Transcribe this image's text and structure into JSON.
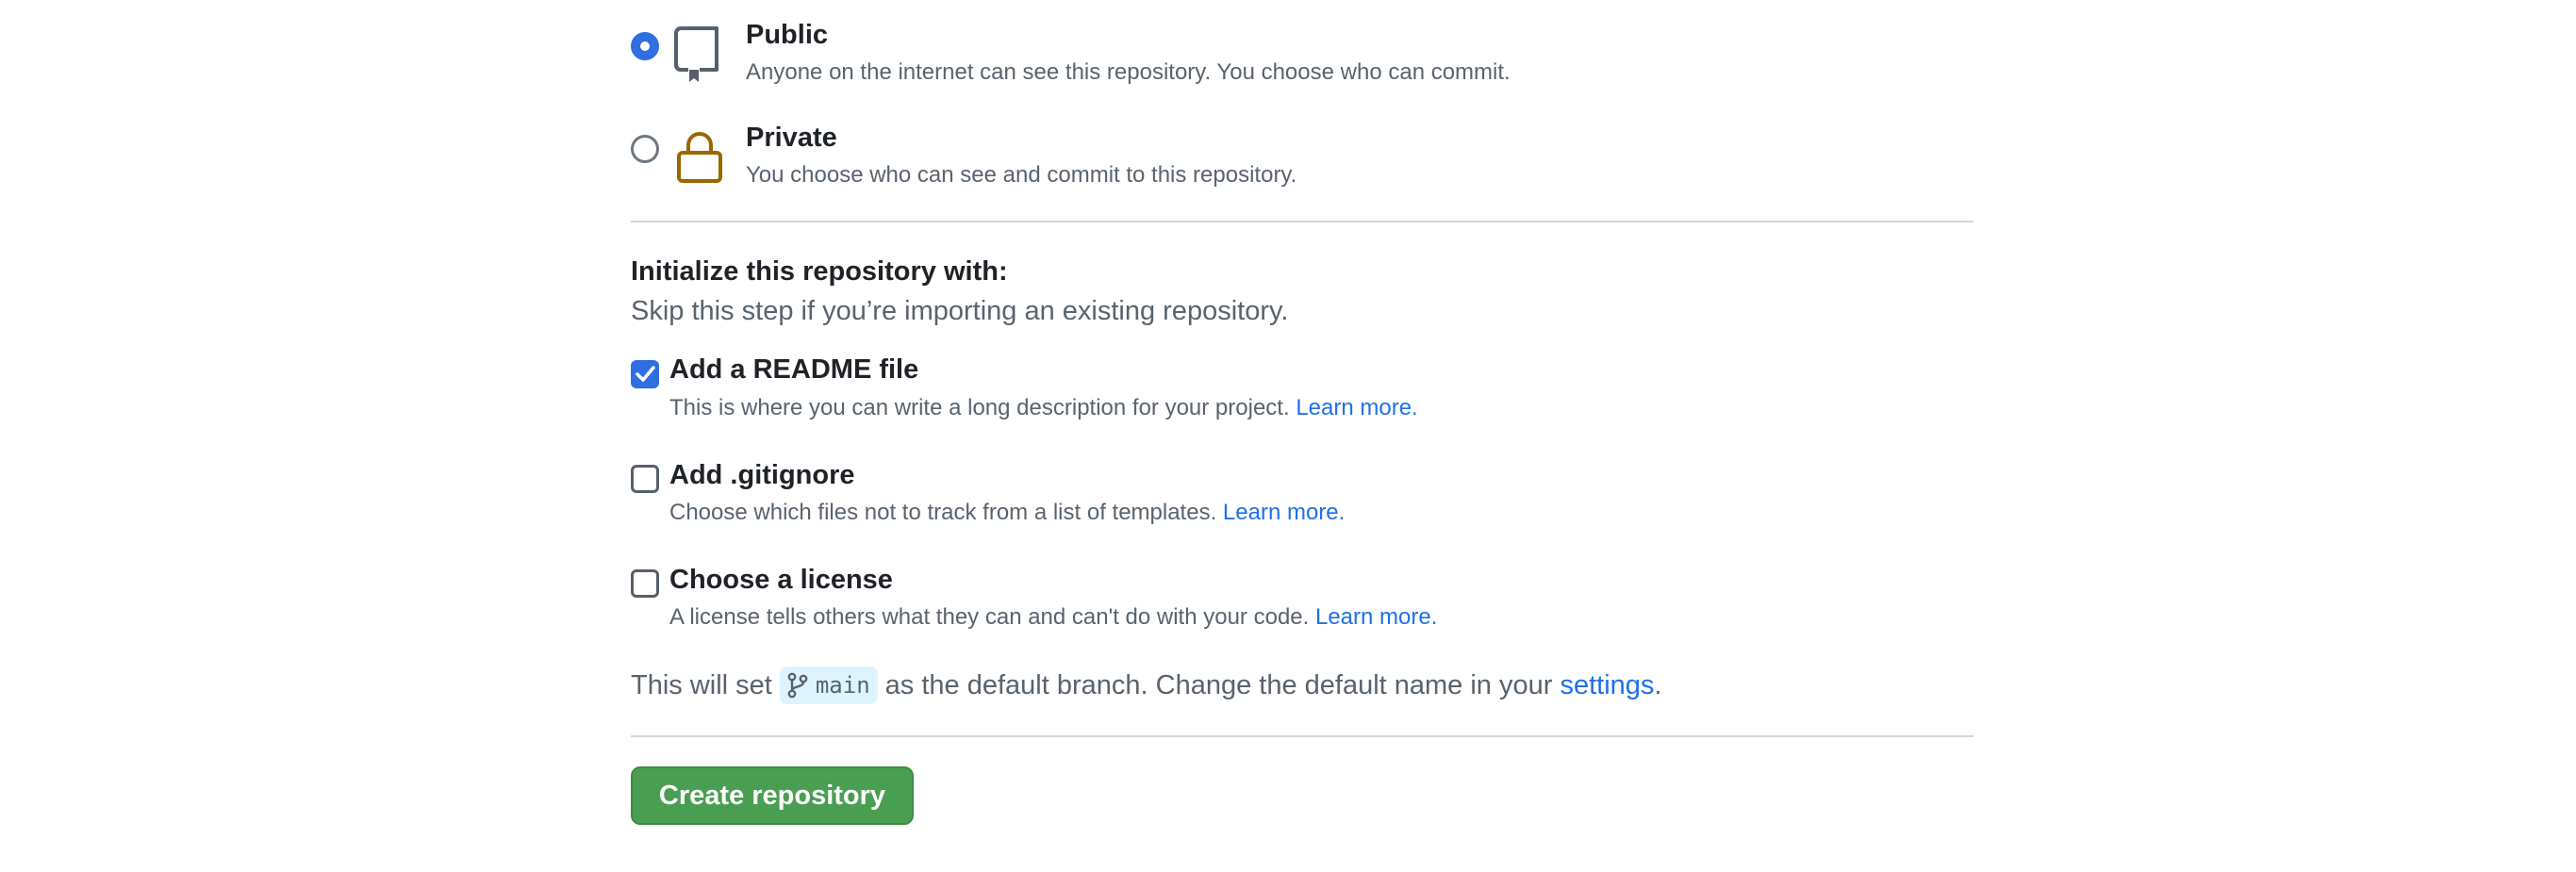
{
  "visibility": {
    "public": {
      "label": "Public",
      "description": "Anyone on the internet can see this repository. You choose who can commit.",
      "selected": true,
      "icon": "repo-icon"
    },
    "private": {
      "label": "Private",
      "description": "You choose who can see and commit to this repository.",
      "selected": false,
      "icon": "lock-icon"
    }
  },
  "initialize": {
    "title": "Initialize this repository with:",
    "subtitle": "Skip this step if you’re importing an existing repository.",
    "options": [
      {
        "label": "Add a README file",
        "description": "This is where you can write a long description for your project.",
        "link": "Learn more.",
        "checked": true
      },
      {
        "label": "Add .gitignore",
        "description": "Choose which files not to track from a list of templates.",
        "link": "Learn more.",
        "checked": false
      },
      {
        "label": "Choose a license",
        "description": "A license tells others what they can and can't do with your code.",
        "link": "Learn more.",
        "checked": false
      }
    ]
  },
  "branch_note": {
    "prefix": "This will set",
    "branch": "main",
    "middle": "as the default branch. Change the default name in your",
    "link": "settings",
    "suffix": "."
  },
  "create_button": {
    "label": "Create repository"
  },
  "colors": {
    "accent": "#2f6fe0",
    "link": "#1f6feb",
    "create_button_bg": "#4a9e52",
    "lock_icon": "#9a6700"
  }
}
